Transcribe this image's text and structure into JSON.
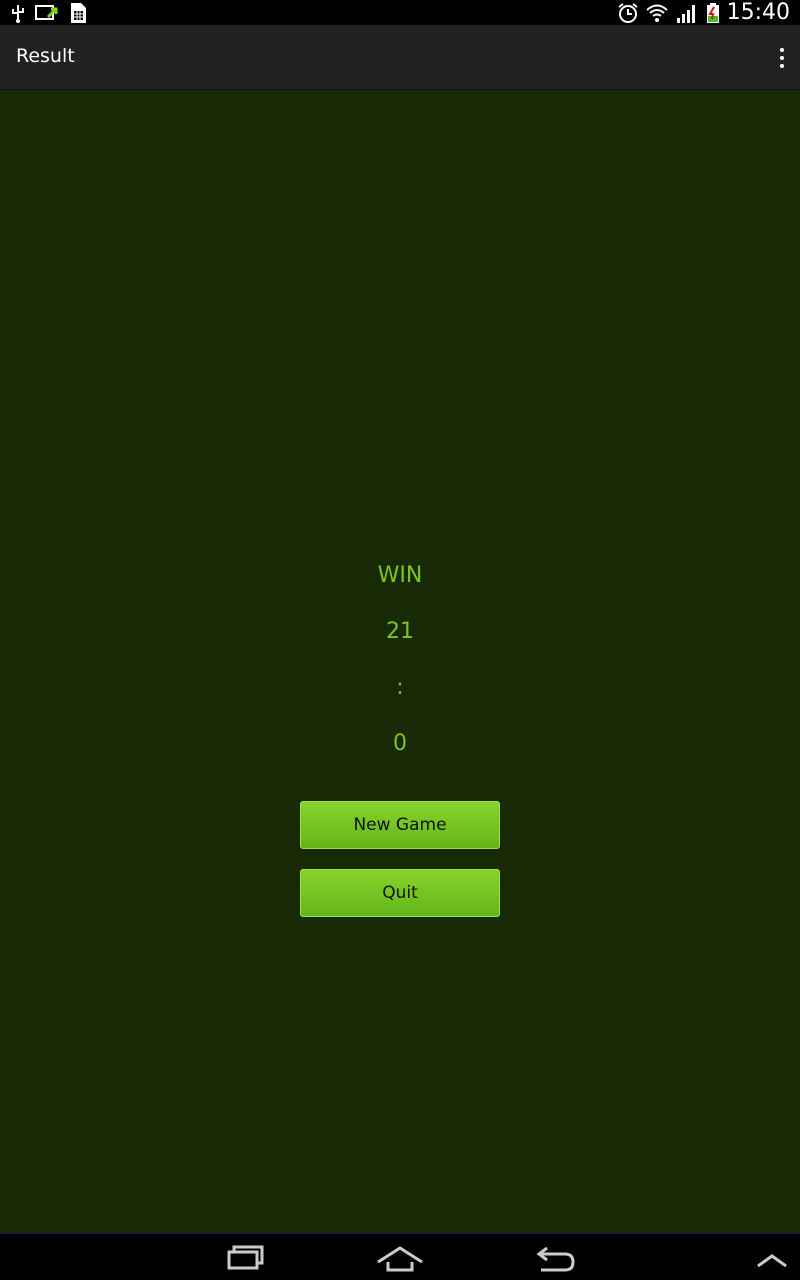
{
  "status_bar": {
    "time": "15:40",
    "left_icons": [
      "usb-icon",
      "screen-cast-icon",
      "sim-card-icon"
    ],
    "right_icons": [
      "alarm-icon",
      "wifi-icon",
      "signal-icon",
      "battery-icon"
    ]
  },
  "action_bar": {
    "title": "Result",
    "overflow_icon": "overflow-menu-icon"
  },
  "result": {
    "status": "WIN",
    "score_left": "21",
    "separator": ":",
    "score_right": "0"
  },
  "buttons": {
    "new_game": "New Game",
    "quit": "Quit"
  },
  "nav_bar": {
    "icons": [
      "recent-apps-icon",
      "home-icon",
      "back-icon",
      "chevron-up-icon"
    ]
  },
  "colors": {
    "background": "#172a05",
    "accent_text": "#7cc520",
    "button": "#76c522",
    "action_bar": "#222222"
  }
}
